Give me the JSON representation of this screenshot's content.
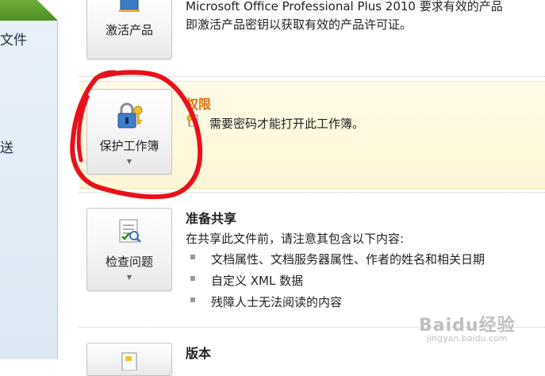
{
  "nav": {
    "items": [
      {
        "label": "文件"
      },
      {
        "label": "送"
      }
    ]
  },
  "activate": {
    "button_label": "激活产品",
    "desc_line1": "Microsoft Office Professional Plus 2010 要求有效的产品",
    "desc_line2": "即激活产品密钥以获取有效的产品许可证。"
  },
  "permissions": {
    "heading": "权限",
    "button_label": "保护工作簿",
    "desc": "需要密码才能打开此工作簿。",
    "heading_color": "#e36c09",
    "annotation_color": "#e8101a"
  },
  "prepare": {
    "heading": "准备共享",
    "button_label": "检查问题",
    "desc": "在共享此文件前，请注意其包含以下内容:",
    "bullets": [
      "文档属性、文档服务器属性、作者的姓名和相关日期",
      "自定义 XML 数据",
      "残障人士无法阅读的内容"
    ]
  },
  "versions": {
    "heading": "版本"
  },
  "watermark": {
    "main": "Baidu经验",
    "sub": "jingyan.baidu.com"
  }
}
